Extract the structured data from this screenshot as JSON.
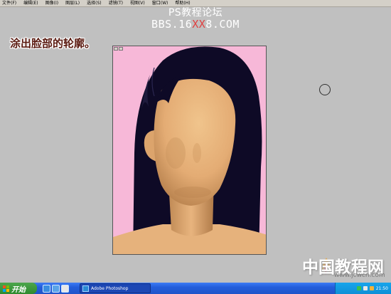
{
  "menu": {
    "items": [
      "文件(F)",
      "编辑(E)",
      "图像(I)",
      "图层(L)",
      "选择(S)",
      "滤镜(T)",
      "视图(V)",
      "窗口(W)",
      "帮助(H)"
    ]
  },
  "watermark": {
    "title": "PS教程论坛",
    "site_prefix": "BBS.16",
    "site_mid": "XX",
    "site_suffix": "8.COM"
  },
  "instruction": "涂出脸部的轮廓。",
  "document": {
    "canvas_color": "#f7b8d8",
    "hair_color": "#0e0a26",
    "skin_color": "#e8b47e"
  },
  "logo": {
    "text": "中国教程网",
    "url": "www.jcwcn.com"
  },
  "taskbar": {
    "start_label": "开始",
    "task_label": "Adobe Photoshop",
    "clock": "21:50"
  }
}
